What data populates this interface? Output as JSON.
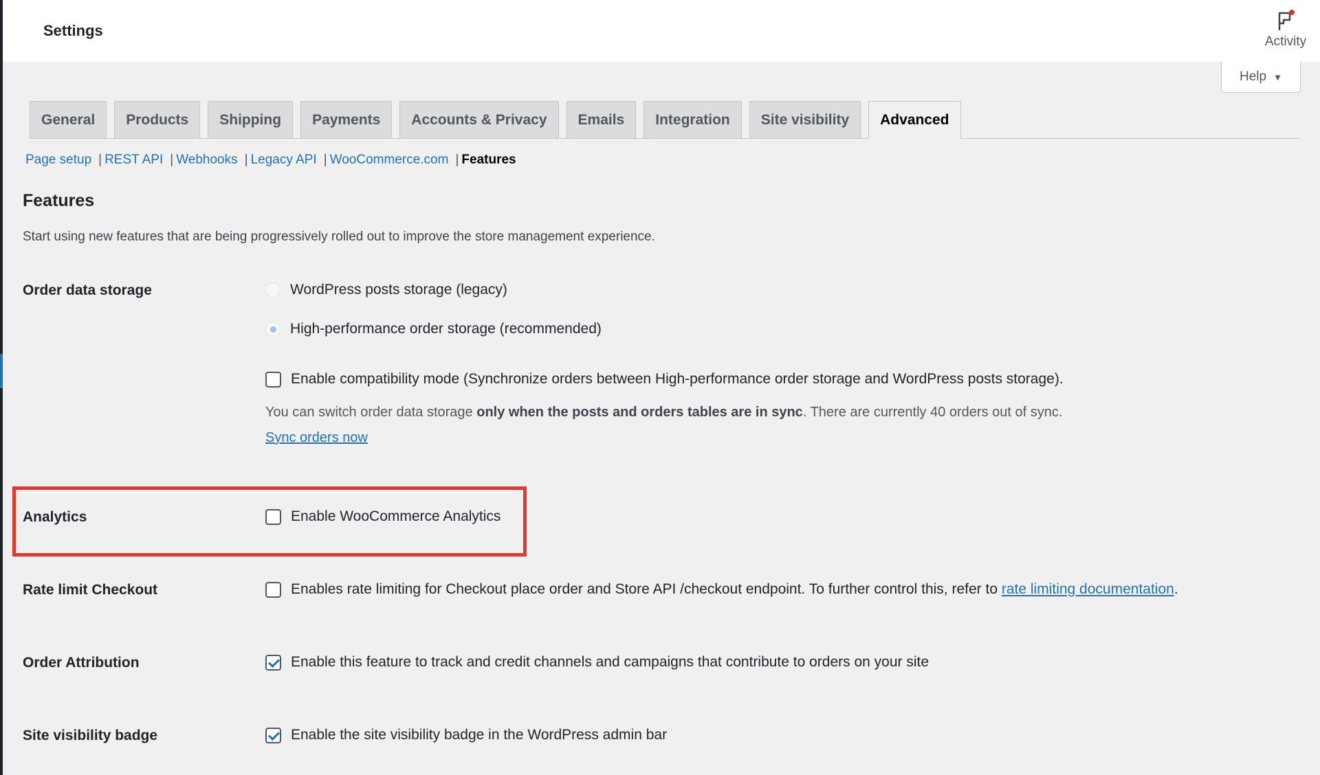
{
  "header": {
    "title": "Settings",
    "activity_label": "Activity"
  },
  "help": {
    "label": "Help"
  },
  "tabs": [
    {
      "label": "General",
      "active": false
    },
    {
      "label": "Products",
      "active": false
    },
    {
      "label": "Shipping",
      "active": false
    },
    {
      "label": "Payments",
      "active": false
    },
    {
      "label": "Accounts & Privacy",
      "active": false
    },
    {
      "label": "Emails",
      "active": false
    },
    {
      "label": "Integration",
      "active": false
    },
    {
      "label": "Site visibility",
      "active": false
    },
    {
      "label": "Advanced",
      "active": true
    }
  ],
  "subnav": {
    "links": [
      "Page setup",
      "REST API",
      "Webhooks",
      "Legacy API",
      "WooCommerce.com"
    ],
    "separator": "|",
    "current": "Features"
  },
  "page": {
    "heading": "Features",
    "description": "Start using new features that are being progressively rolled out to improve the store management experience."
  },
  "order_storage": {
    "label": "Order data storage",
    "option_legacy": "WordPress posts storage (legacy)",
    "option_legacy_checked": false,
    "option_hpos": "High-performance order storage (recommended)",
    "option_hpos_checked": true,
    "compat_label": "Enable compatibility mode (Synchronize orders between High-performance order storage and WordPress posts storage).",
    "compat_checked": false,
    "note_prefix": "You can switch order data storage ",
    "note_bold": "only when the posts and orders tables are in sync",
    "note_suffix": ". There are currently 40 orders out of sync.",
    "sync_link": "Sync orders now"
  },
  "analytics": {
    "label": "Analytics",
    "option": "Enable WooCommerce Analytics",
    "checked": false,
    "highlight_color": "#e03a2f"
  },
  "rate_limit": {
    "label": "Rate limit Checkout",
    "option_prefix": "Enables rate limiting for Checkout place order and Store API /checkout endpoint. To further control this, refer to ",
    "option_link": "rate limiting documentation",
    "option_suffix": ".",
    "checked": false
  },
  "order_attribution": {
    "label": "Order Attribution",
    "option": "Enable this feature to track and credit channels and campaigns that contribute to orders on your site",
    "checked": true
  },
  "site_visibility_badge": {
    "label": "Site visibility badge",
    "option": "Enable the site visibility badge in the WordPress admin bar",
    "checked": true
  },
  "icons": {
    "activity": "flag-icon",
    "help_caret": "caret-down-icon"
  },
  "colors": {
    "link": "#2271b1",
    "highlight": "#e03a2f",
    "notification_dot": "#d63638"
  }
}
